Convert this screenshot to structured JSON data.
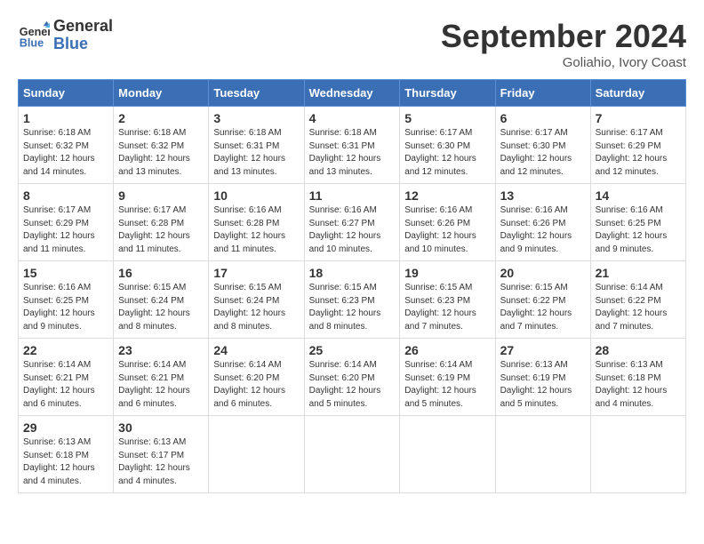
{
  "header": {
    "logo_line1": "General",
    "logo_line2": "Blue",
    "month_title": "September 2024",
    "location": "Goliahio, Ivory Coast"
  },
  "weekdays": [
    "Sunday",
    "Monday",
    "Tuesday",
    "Wednesday",
    "Thursday",
    "Friday",
    "Saturday"
  ],
  "weeks": [
    [
      {
        "day": "1",
        "info": "Sunrise: 6:18 AM\nSunset: 6:32 PM\nDaylight: 12 hours\nand 14 minutes."
      },
      {
        "day": "2",
        "info": "Sunrise: 6:18 AM\nSunset: 6:32 PM\nDaylight: 12 hours\nand 13 minutes."
      },
      {
        "day": "3",
        "info": "Sunrise: 6:18 AM\nSunset: 6:31 PM\nDaylight: 12 hours\nand 13 minutes."
      },
      {
        "day": "4",
        "info": "Sunrise: 6:18 AM\nSunset: 6:31 PM\nDaylight: 12 hours\nand 13 minutes."
      },
      {
        "day": "5",
        "info": "Sunrise: 6:17 AM\nSunset: 6:30 PM\nDaylight: 12 hours\nand 12 minutes."
      },
      {
        "day": "6",
        "info": "Sunrise: 6:17 AM\nSunset: 6:30 PM\nDaylight: 12 hours\nand 12 minutes."
      },
      {
        "day": "7",
        "info": "Sunrise: 6:17 AM\nSunset: 6:29 PM\nDaylight: 12 hours\nand 12 minutes."
      }
    ],
    [
      {
        "day": "8",
        "info": "Sunrise: 6:17 AM\nSunset: 6:29 PM\nDaylight: 12 hours\nand 11 minutes."
      },
      {
        "day": "9",
        "info": "Sunrise: 6:17 AM\nSunset: 6:28 PM\nDaylight: 12 hours\nand 11 minutes."
      },
      {
        "day": "10",
        "info": "Sunrise: 6:16 AM\nSunset: 6:28 PM\nDaylight: 12 hours\nand 11 minutes."
      },
      {
        "day": "11",
        "info": "Sunrise: 6:16 AM\nSunset: 6:27 PM\nDaylight: 12 hours\nand 10 minutes."
      },
      {
        "day": "12",
        "info": "Sunrise: 6:16 AM\nSunset: 6:26 PM\nDaylight: 12 hours\nand 10 minutes."
      },
      {
        "day": "13",
        "info": "Sunrise: 6:16 AM\nSunset: 6:26 PM\nDaylight: 12 hours\nand 9 minutes."
      },
      {
        "day": "14",
        "info": "Sunrise: 6:16 AM\nSunset: 6:25 PM\nDaylight: 12 hours\nand 9 minutes."
      }
    ],
    [
      {
        "day": "15",
        "info": "Sunrise: 6:16 AM\nSunset: 6:25 PM\nDaylight: 12 hours\nand 9 minutes."
      },
      {
        "day": "16",
        "info": "Sunrise: 6:15 AM\nSunset: 6:24 PM\nDaylight: 12 hours\nand 8 minutes."
      },
      {
        "day": "17",
        "info": "Sunrise: 6:15 AM\nSunset: 6:24 PM\nDaylight: 12 hours\nand 8 minutes."
      },
      {
        "day": "18",
        "info": "Sunrise: 6:15 AM\nSunset: 6:23 PM\nDaylight: 12 hours\nand 8 minutes."
      },
      {
        "day": "19",
        "info": "Sunrise: 6:15 AM\nSunset: 6:23 PM\nDaylight: 12 hours\nand 7 minutes."
      },
      {
        "day": "20",
        "info": "Sunrise: 6:15 AM\nSunset: 6:22 PM\nDaylight: 12 hours\nand 7 minutes."
      },
      {
        "day": "21",
        "info": "Sunrise: 6:14 AM\nSunset: 6:22 PM\nDaylight: 12 hours\nand 7 minutes."
      }
    ],
    [
      {
        "day": "22",
        "info": "Sunrise: 6:14 AM\nSunset: 6:21 PM\nDaylight: 12 hours\nand 6 minutes."
      },
      {
        "day": "23",
        "info": "Sunrise: 6:14 AM\nSunset: 6:21 PM\nDaylight: 12 hours\nand 6 minutes."
      },
      {
        "day": "24",
        "info": "Sunrise: 6:14 AM\nSunset: 6:20 PM\nDaylight: 12 hours\nand 6 minutes."
      },
      {
        "day": "25",
        "info": "Sunrise: 6:14 AM\nSunset: 6:20 PM\nDaylight: 12 hours\nand 5 minutes."
      },
      {
        "day": "26",
        "info": "Sunrise: 6:14 AM\nSunset: 6:19 PM\nDaylight: 12 hours\nand 5 minutes."
      },
      {
        "day": "27",
        "info": "Sunrise: 6:13 AM\nSunset: 6:19 PM\nDaylight: 12 hours\nand 5 minutes."
      },
      {
        "day": "28",
        "info": "Sunrise: 6:13 AM\nSunset: 6:18 PM\nDaylight: 12 hours\nand 4 minutes."
      }
    ],
    [
      {
        "day": "29",
        "info": "Sunrise: 6:13 AM\nSunset: 6:18 PM\nDaylight: 12 hours\nand 4 minutes."
      },
      {
        "day": "30",
        "info": "Sunrise: 6:13 AM\nSunset: 6:17 PM\nDaylight: 12 hours\nand 4 minutes."
      },
      null,
      null,
      null,
      null,
      null
    ]
  ]
}
